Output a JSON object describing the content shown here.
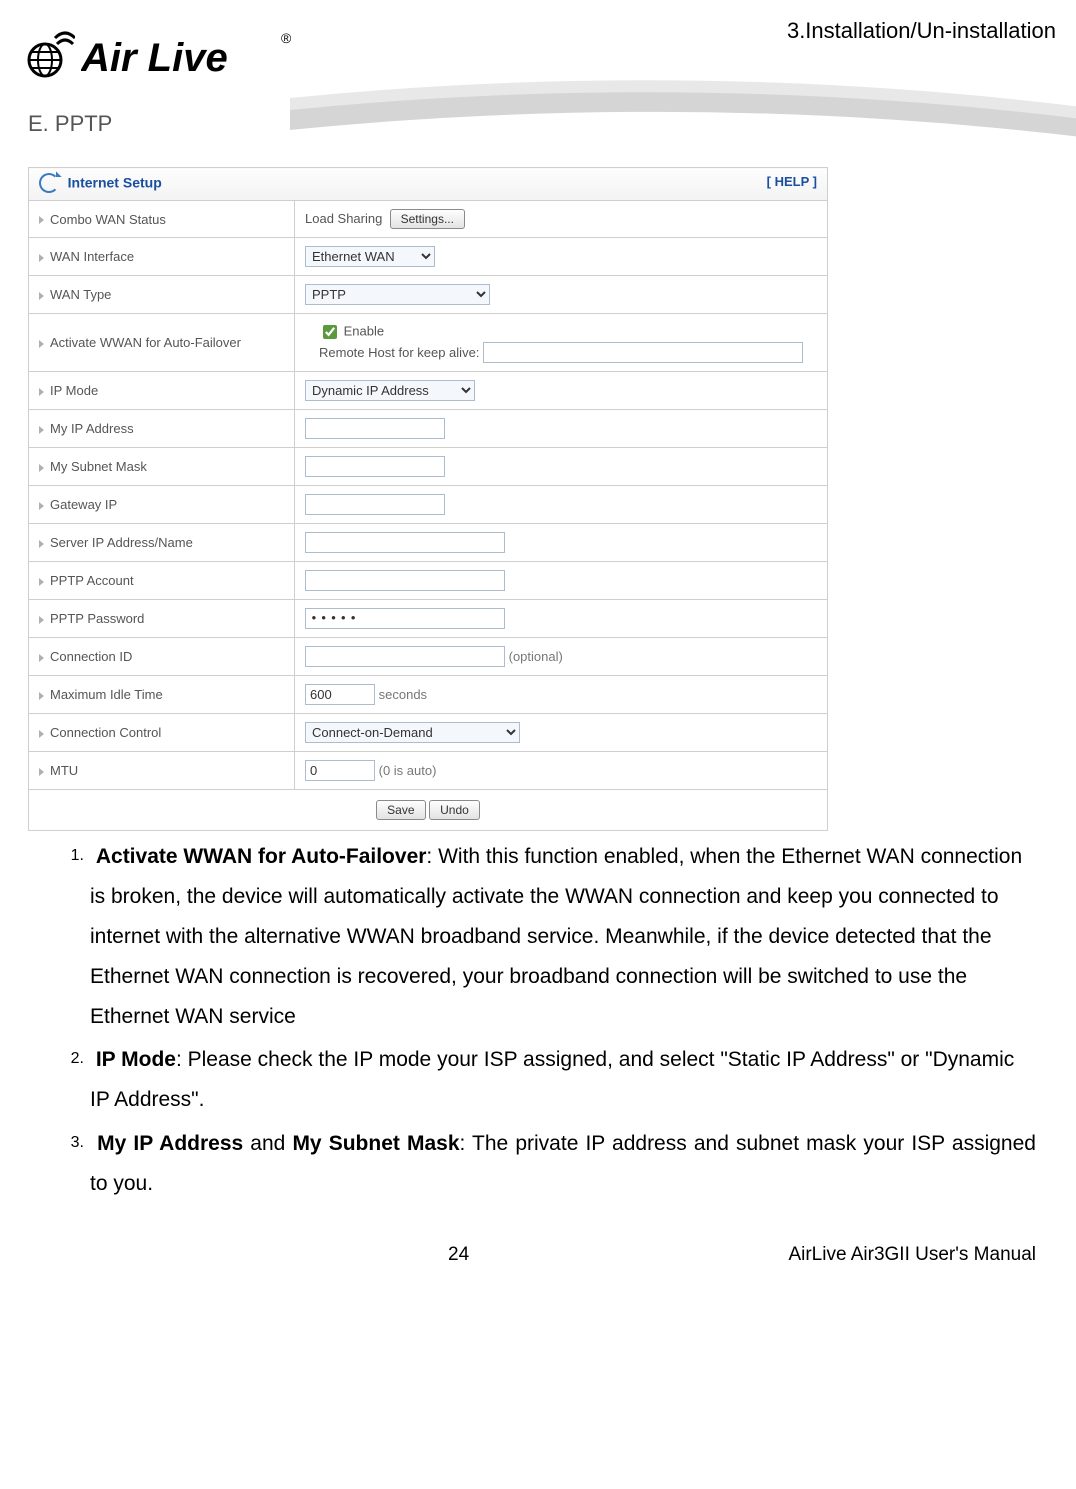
{
  "header": {
    "chapter": "3.Installation/Un-installation",
    "logo_text": "Air Live",
    "logo_trademark": "®"
  },
  "section_title": "E. PPTP",
  "panel": {
    "title": "Internet Setup",
    "help": "[ HELP ]",
    "rows": {
      "combo_wan_status": {
        "label": "Combo WAN Status",
        "value": "Load Sharing",
        "button": "Settings..."
      },
      "wan_interface": {
        "label": "WAN Interface",
        "value": "Ethernet WAN"
      },
      "wan_type": {
        "label": "WAN Type",
        "value": "PPTP"
      },
      "wwan_failover": {
        "label": "Activate WWAN for Auto-Failover",
        "checkbox_label": "Enable",
        "sublabel": "Remote Host for keep alive:",
        "sub_value": ""
      },
      "ip_mode": {
        "label": "IP Mode",
        "value": "Dynamic IP Address"
      },
      "my_ip": {
        "label": "My IP Address",
        "value": ""
      },
      "subnet": {
        "label": "My Subnet Mask",
        "value": ""
      },
      "gateway": {
        "label": "Gateway IP",
        "value": ""
      },
      "server_ip": {
        "label": "Server IP Address/Name",
        "value": ""
      },
      "pptp_acc": {
        "label": "PPTP Account",
        "value": ""
      },
      "pptp_pwd": {
        "label": "PPTP Password",
        "value": "•••••"
      },
      "conn_id": {
        "label": "Connection ID",
        "value": "",
        "suffix": "(optional)"
      },
      "idle_time": {
        "label": "Maximum Idle Time",
        "value": "600",
        "suffix": "seconds"
      },
      "conn_ctrl": {
        "label": "Connection Control",
        "value": "Connect-on-Demand"
      },
      "mtu": {
        "label": "MTU",
        "value": "0",
        "suffix": "(0 is auto)"
      }
    },
    "buttons": {
      "save": "Save",
      "undo": "Undo"
    }
  },
  "doc": {
    "item1_num": "1.",
    "item1_bold": "Activate WWAN for Auto-Failover",
    "item1_rest": ": With this function enabled, when the Ethernet WAN connection is broken, the device will automatically activate the WWAN connection and keep you connected to internet with the alternative WWAN broadband service. Meanwhile, if the device detected that the Ethernet WAN connection is recovered, your broadband connection will be switched to use the Ethernet WAN service",
    "item2_num": "2.",
    "item2_bold": "IP Mode",
    "item2_rest": ": Please check the IP mode your ISP assigned, and select \"Static IP Address\" or \"Dynamic IP Address\".",
    "item3_num": "3.",
    "item3_bold1": "My IP Address",
    "item3_mid": " and ",
    "item3_bold2": "My Subnet Mask",
    "item3_rest": ": The private IP address and subnet mask your ISP assigned to you."
  },
  "footer": {
    "page": "24",
    "manual": "AirLive Air3GII User's Manual"
  }
}
